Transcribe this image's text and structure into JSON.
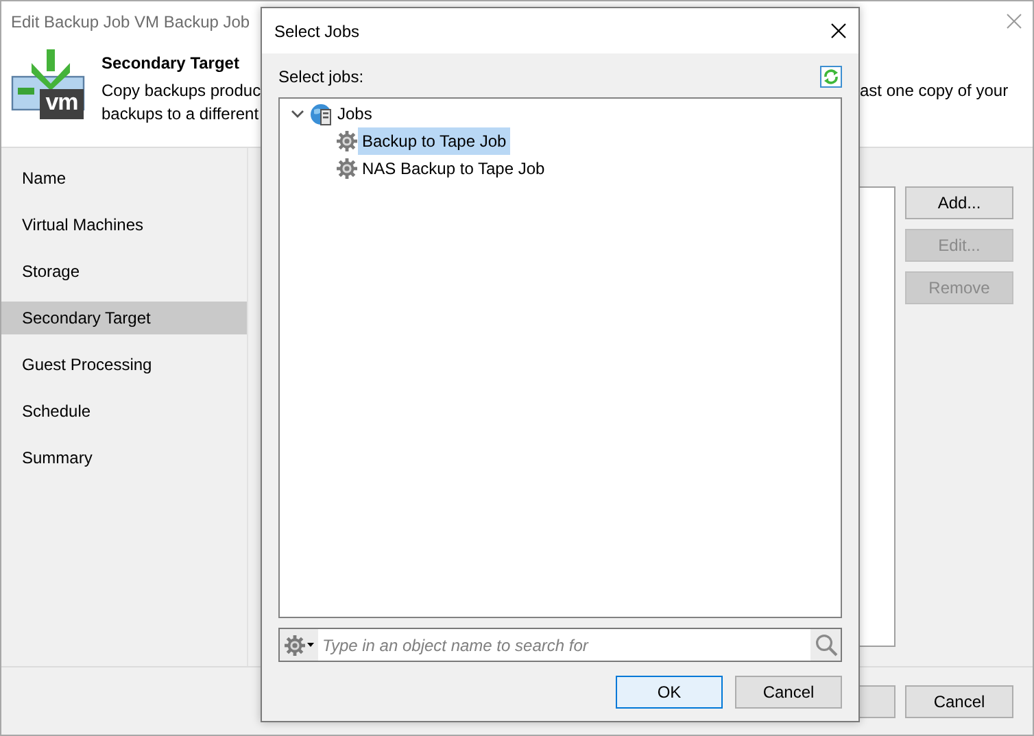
{
  "window": {
    "title": "Edit Backup Job VM Backup Job"
  },
  "header": {
    "icon_label": "vm",
    "title": "Secondary Target",
    "description_left": [
      "Copy backups produc",
      "backups to a different"
    ],
    "description_right": "ast one copy of your"
  },
  "steps": [
    {
      "label": "Name",
      "selected": false
    },
    {
      "label": "Virtual Machines",
      "selected": false
    },
    {
      "label": "Storage",
      "selected": false
    },
    {
      "label": "Secondary Target",
      "selected": true
    },
    {
      "label": "Guest Processing",
      "selected": false
    },
    {
      "label": "Schedule",
      "selected": false
    },
    {
      "label": "Summary",
      "selected": false
    }
  ],
  "side_buttons": [
    {
      "label": "Add...",
      "disabled": false
    },
    {
      "label": "Edit...",
      "disabled": true
    },
    {
      "label": "Remove",
      "disabled": true
    }
  ],
  "footer_buttons": [
    {
      "label": "Cancel"
    }
  ],
  "dialog": {
    "title": "Select Jobs",
    "list_label": "Select jobs:",
    "tree": [
      {
        "label": "Jobs",
        "kind": "folder",
        "expanded": true,
        "selected": false,
        "children": [
          {
            "label": "Backup to Tape Job",
            "kind": "job",
            "selected": true
          },
          {
            "label": "NAS Backup to Tape Job",
            "kind": "job",
            "selected": false
          }
        ]
      }
    ],
    "search": {
      "placeholder": "Type in an object name to search for"
    },
    "buttons": [
      {
        "label": "OK",
        "default": true
      },
      {
        "label": "Cancel",
        "default": false
      }
    ]
  }
}
